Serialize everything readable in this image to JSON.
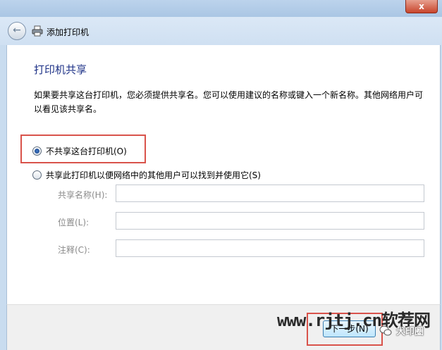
{
  "window": {
    "close_glyph": "x"
  },
  "nav": {
    "title": "添加打印机"
  },
  "content": {
    "heading": "打印机共享",
    "description": "如果要共享这台打印机，您必须提供共享名。您可以使用建议的名称或键入一个新名称。其他网络用户可以看见该共享名。",
    "option_no_share": {
      "label": "不共享这台打印机(O)",
      "selected": true
    },
    "option_share": {
      "label": "共享此打印机以便网络中的其他用户可以找到并使用它(S)",
      "selected": false
    },
    "fields": [
      {
        "label": "共享名称(H):",
        "value": ""
      },
      {
        "label": "位置(L):",
        "value": ""
      },
      {
        "label": "注释(C):",
        "value": ""
      }
    ]
  },
  "footer": {
    "next_button": "下一步(N)"
  },
  "watermark": {
    "site": "www.rjtj.cn软荐网",
    "wechat_label": "犬印圈"
  },
  "colors": {
    "heading": "#1e3287",
    "highlight": "#d9534b"
  }
}
